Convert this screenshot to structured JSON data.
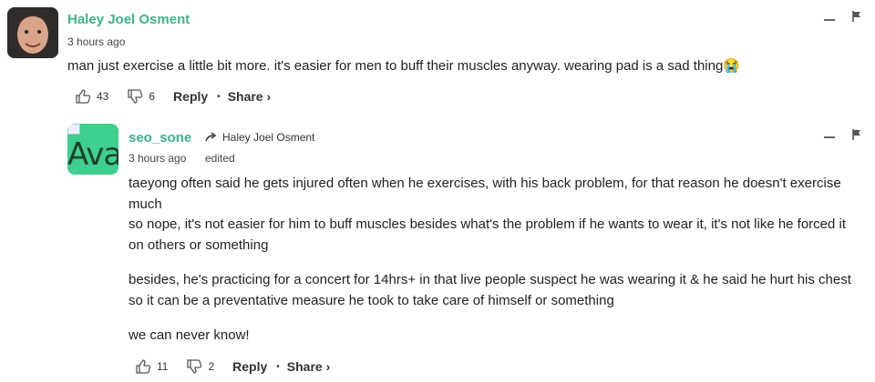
{
  "comments": [
    {
      "user": "Haley Joel Osment",
      "time": "3 hours ago",
      "text": "man just exercise a little bit more. it's easier for men to buff their muscles anyway. wearing pad is a sad thing😭",
      "likes": "43",
      "dislikes": "6",
      "reply_label": "Reply",
      "share_label": "Share ›"
    },
    {
      "user": "seo_sone",
      "avatar_text": "Ava",
      "reply_to": "Haley Joel Osment",
      "time": "3 hours ago",
      "edited": "edited",
      "paragraphs": [
        "taeyong often said he gets injured often when he exercises, with his back problem, for that reason he doesn't exercise much",
        "so nope, it's not easier for him to buff muscles besides what's the problem if he wants to wear it, it's not like he forced it on others or something",
        "besides, he's practicing for a concert for 14hrs+ in that live people suspect he was wearing it & he said he hurt his chest so it can be a preventative measure he took to take care of himself or something",
        "we can never know!"
      ],
      "likes": "11",
      "dislikes": "2",
      "reply_label": "Reply",
      "share_label": "Share ›"
    }
  ]
}
